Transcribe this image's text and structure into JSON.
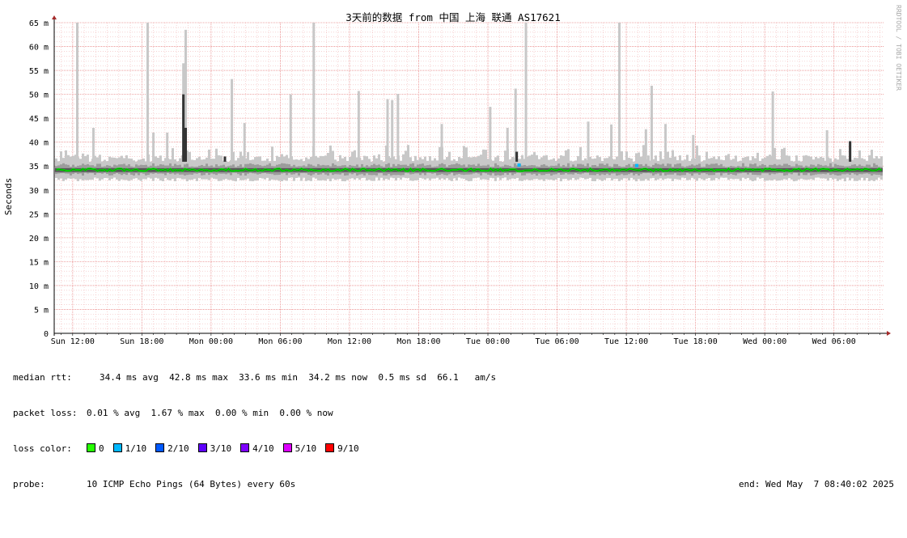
{
  "chart_data": {
    "type": "area",
    "title": "3天前的数据 from 中国 上海 联通 AS17621",
    "ylabel": "Seconds",
    "side_label": "RRDTOOL / TOBI OETIKER",
    "ylim": [
      0,
      65
    ],
    "y_ticks": [
      {
        "value": 0,
        "label": "0"
      },
      {
        "value": 5,
        "label": "5 m"
      },
      {
        "value": 10,
        "label": "10 m"
      },
      {
        "value": 15,
        "label": "15 m"
      },
      {
        "value": 20,
        "label": "20 m"
      },
      {
        "value": 25,
        "label": "25 m"
      },
      {
        "value": 30,
        "label": "30 m"
      },
      {
        "value": 35,
        "label": "35 m"
      },
      {
        "value": 40,
        "label": "40 m"
      },
      {
        "value": 45,
        "label": "45 m"
      },
      {
        "value": 50,
        "label": "50 m"
      },
      {
        "value": 55,
        "label": "55 m"
      },
      {
        "value": 60,
        "label": "60 m"
      },
      {
        "value": 65,
        "label": "65 m"
      }
    ],
    "x_ticks": [
      "Sun 12:00",
      "Sun 18:00",
      "Mon 00:00",
      "Mon 06:00",
      "Mon 12:00",
      "Mon 18:00",
      "Tue 00:00",
      "Tue 06:00",
      "Tue 12:00",
      "Tue 18:00",
      "Wed 00:00",
      "Wed 06:00"
    ],
    "x_range_hours": [
      -1.6,
      70.3
    ],
    "grid": true,
    "baseline_ms": 34.2,
    "smoke_band_ms": [
      32.6,
      35.9
    ],
    "spikes": [
      {
        "hour": 0.4,
        "max_ms": 65
      },
      {
        "hour": 1.8,
        "max_ms": 43
      },
      {
        "hour": 6.5,
        "max_ms": 65
      },
      {
        "hour": 7.0,
        "max_ms": 42
      },
      {
        "hour": 8.2,
        "max_ms": 42
      },
      {
        "hour": 9.6,
        "max_ms": 56.5
      },
      {
        "hour": 9.8,
        "max_ms": 63.5
      },
      {
        "hour": 13.8,
        "max_ms": 53.2
      },
      {
        "hour": 14.9,
        "max_ms": 44
      },
      {
        "hour": 18.9,
        "max_ms": 50
      },
      {
        "hour": 20.9,
        "max_ms": 65
      },
      {
        "hour": 24.8,
        "max_ms": 50.7
      },
      {
        "hour": 27.3,
        "max_ms": 49
      },
      {
        "hour": 27.7,
        "max_ms": 48.8
      },
      {
        "hour": 28.2,
        "max_ms": 50.1
      },
      {
        "hour": 32.0,
        "max_ms": 43.8
      },
      {
        "hour": 36.2,
        "max_ms": 47.4
      },
      {
        "hour": 37.7,
        "max_ms": 43
      },
      {
        "hour": 38.4,
        "max_ms": 51.2
      },
      {
        "hour": 39.3,
        "max_ms": 65
      },
      {
        "hour": 44.7,
        "max_ms": 44.3
      },
      {
        "hour": 46.7,
        "max_ms": 43.7
      },
      {
        "hour": 47.4,
        "max_ms": 65
      },
      {
        "hour": 49.7,
        "max_ms": 42.7
      },
      {
        "hour": 50.2,
        "max_ms": 51.8
      },
      {
        "hour": 51.4,
        "max_ms": 43.8
      },
      {
        "hour": 53.8,
        "max_ms": 41.5
      },
      {
        "hour": 60.7,
        "max_ms": 50.6
      },
      {
        "hour": 65.4,
        "max_ms": 42.5
      },
      {
        "hour": 67.4,
        "max_ms": 40.2
      }
    ],
    "dark_spikes": [
      {
        "hour": 9.6,
        "max_ms": 50
      },
      {
        "hour": 9.8,
        "max_ms": 43
      },
      {
        "hour": 13.2,
        "max_ms": 37
      },
      {
        "hour": 38.5,
        "max_ms": 38
      },
      {
        "hour": 67.4,
        "max_ms": 40.2
      }
    ],
    "loss_points": [
      {
        "hour": 38.7,
        "ms": 35.2,
        "loss": "1/10"
      },
      {
        "hour": 48.9,
        "ms": 35.1,
        "loss": "1/10"
      }
    ]
  },
  "colors": {
    "median": "#00ee00",
    "grid_minor": "#f2b8b8",
    "grid_major": "#e98a8a",
    "smoke_light": "#c8c8c8",
    "smoke_mid": "#9c9c9c",
    "smoke_dark": "#555555",
    "axis_arrow": "#a52a2a"
  },
  "stats": {
    "median_rtt_label": "median rtt:",
    "median_rtt_value": "34.4 ms avg  42.8 ms max  33.6 ms min  34.2 ms now  0.5 ms sd  66.1   am/s",
    "packet_loss_label": "packet loss:",
    "packet_loss_value": "0.01 % avg  1.67 % max  0.00 % min  0.00 % now",
    "loss_color_label": "loss color:",
    "loss_colors": [
      {
        "label": "0",
        "color": "#26ff00"
      },
      {
        "label": "1/10",
        "color": "#00b8ff"
      },
      {
        "label": "2/10",
        "color": "#0059ff"
      },
      {
        "label": "3/10",
        "color": "#5e00ff"
      },
      {
        "label": "4/10",
        "color": "#7e00ff"
      },
      {
        "label": "5/10",
        "color": "#dd00ff"
      },
      {
        "label": "9/10",
        "color": "#ff0000"
      }
    ],
    "probe_label": "probe:",
    "probe_value": "10 ICMP Echo Pings (64 Bytes) every 60s",
    "end_text": "end: Wed May  7 08:40:02 2025"
  }
}
